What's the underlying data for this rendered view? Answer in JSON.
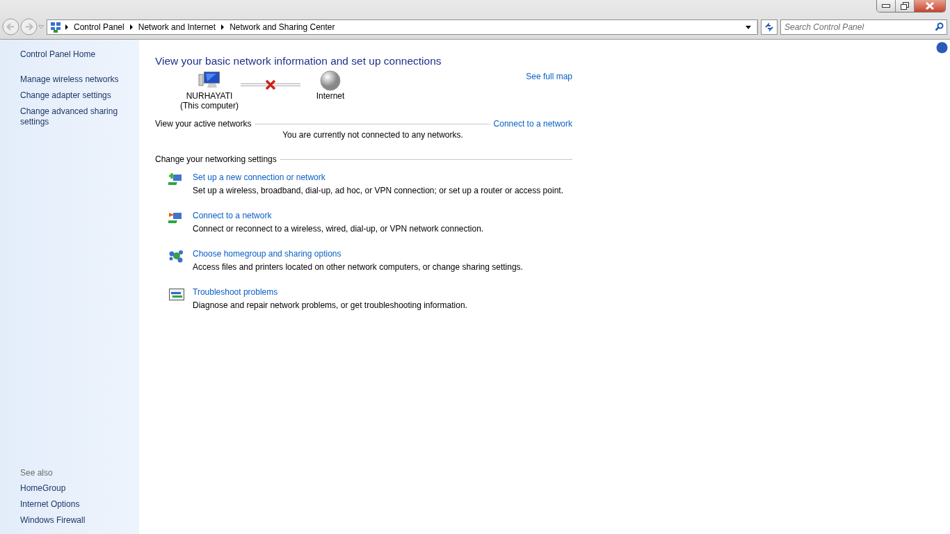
{
  "address_bar": {
    "breadcrumbs": [
      "Control Panel",
      "Network and Internet",
      "Network and Sharing Center"
    ]
  },
  "search": {
    "placeholder": "Search Control Panel"
  },
  "sidebar": {
    "home": "Control Panel Home",
    "tasks": [
      "Manage wireless networks",
      "Change adapter settings",
      "Change advanced sharing settings"
    ],
    "see_also_heading": "See also",
    "see_also": [
      "HomeGroup",
      "Internet Options",
      "Windows Firewall"
    ]
  },
  "main": {
    "heading": "View your basic network information and set up connections",
    "see_full_map": "See full map",
    "network_map": {
      "computer": {
        "name": "NURHAYATI",
        "caption": "(This computer)"
      },
      "connected": false,
      "internet": {
        "name": "Internet"
      }
    },
    "active_networks": {
      "label": "View your active networks",
      "link": "Connect to a network",
      "message": "You are currently not connected to any networks."
    },
    "settings": {
      "label": "Change your networking settings",
      "tasks": [
        {
          "kind": "new-connection",
          "title": "Set up a new connection or network",
          "description": "Set up a wireless, broadband, dial-up, ad hoc, or VPN connection; or set up a router or access point."
        },
        {
          "kind": "connect",
          "title": "Connect to a network",
          "description": "Connect or reconnect to a wireless, wired, dial-up, or VPN network connection."
        },
        {
          "kind": "homegroup",
          "title": "Choose homegroup and sharing options",
          "description": "Access files and printers located on other network computers, or change sharing settings."
        },
        {
          "kind": "troubleshoot",
          "title": "Troubleshoot problems",
          "description": "Diagnose and repair network problems, or get troubleshooting information."
        }
      ]
    }
  }
}
